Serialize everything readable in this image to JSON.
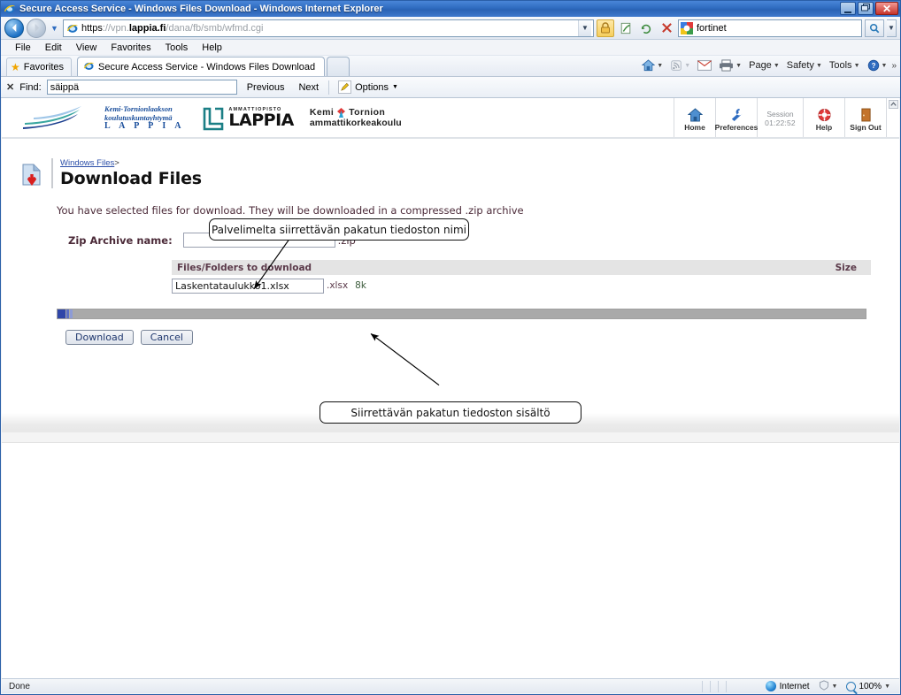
{
  "window": {
    "title": "Secure Access Service - Windows Files Download - Windows Internet Explorer",
    "minimize_label": "Minimize",
    "restore_label": "Restore",
    "close_label": "✕"
  },
  "address_bar": {
    "protocol": "https",
    "sep": "://",
    "subdomain": "vpn.",
    "host": "lappia.fi",
    "path": "/dana/fb/smb/wfmd.cgi",
    "back_label": "◀",
    "forward_label": "▶",
    "history_caret": "▼",
    "dropdown_caret": "▼",
    "lock_icon": "lock-icon",
    "compat_icon": "compatibility-view-icon",
    "refresh_icon": "refresh-icon",
    "stop_icon": "stop-icon"
  },
  "search": {
    "value": "fortinet",
    "provider_icon": "google-icon",
    "go_icon": "search-icon",
    "caret": "▼"
  },
  "menu": {
    "items": [
      "File",
      "Edit",
      "View",
      "Favorites",
      "Tools",
      "Help"
    ]
  },
  "favorites": {
    "label": "Favorites",
    "star_icon": "★"
  },
  "tabs": [
    {
      "label": "Secure Access Service - Windows Files Download",
      "active": true
    },
    {
      "label": "",
      "active": false
    }
  ],
  "command_bar": {
    "home_icon": "home-icon",
    "feeds_icon": "feeds-icon",
    "mail_icon": "mail-icon",
    "print_icon": "print-icon",
    "items": [
      "Page",
      "Safety",
      "Tools"
    ],
    "help_label": "?",
    "overflow": "»",
    "caret": "▼"
  },
  "find_bar": {
    "close_label": "✕",
    "label": "Find:",
    "value": "säippä",
    "previous": "Previous",
    "next": "Next",
    "options": "Options",
    "caret": "▼",
    "highlight_icon": "highlighter-icon"
  },
  "branding": {
    "logo1": {
      "line1": "Kemi-Tornionlaakson",
      "line2": "koulutuskuntayhtymä",
      "line3": "L A P P I A",
      "wave_icon": "wave-logo-icon"
    },
    "logo2": {
      "top": "AMMATTIOPISTO",
      "big": "LAPPIA",
      "mark_icon": "lappia-mark-icon"
    },
    "logo3": {
      "row1a": "Kemi",
      "row1b": "Tornion",
      "row2": "ammattikorkeakoulu",
      "kite_icon": "kite-icon"
    }
  },
  "nav_icons": [
    {
      "label": "Home",
      "icon": "home-icon"
    },
    {
      "label": "Preferences",
      "icon": "wrench-icon"
    }
  ],
  "session": {
    "label": "Session",
    "time": "01:22:52"
  },
  "nav_icons2": [
    {
      "label": "Help",
      "icon": "lifering-icon"
    },
    {
      "label": "Sign Out",
      "icon": "door-icon"
    }
  ],
  "collapse_caret": "⌃",
  "main": {
    "breadcrumb_link": "Windows Files",
    "breadcrumb_sep": ">",
    "page_title": "Download Files",
    "page_icon": "download-file-icon",
    "intro": "You have selected files for download. They will be downloaded in a compressed .zip archive",
    "zip_label": "Zip Archive name:",
    "zip_value": "",
    "zip_extension": ".zip",
    "table": {
      "headers": [
        "Files/Folders to download",
        "Size"
      ],
      "rows": [
        {
          "name": "Laskentataulukko1.xlsx",
          "extension": ".xlsx",
          "size": "8k"
        }
      ]
    },
    "download_button": "Download",
    "cancel_button": "Cancel"
  },
  "callouts": [
    {
      "text": "Palvelimelta siirrettävän pakatun tiedoston nimi"
    },
    {
      "text": "Siirrettävän pakatun tiedoston sisältö"
    }
  ],
  "status_bar": {
    "status": "Done",
    "zone": "Internet",
    "protected_caret": "▼",
    "zoom": "100%",
    "zoom_caret": "▼",
    "zone_icon": "globe-icon",
    "protected_icon": "protected-mode-icon",
    "zoom_icon": "magnifier-icon"
  },
  "colors": {
    "title_bar": "#2f6cc0",
    "breadcrumb_link": "#2b4ea8",
    "body_text": "#4b2a38",
    "progress_fill": "#2f46a8",
    "progress_track": "#a9a9a9"
  }
}
